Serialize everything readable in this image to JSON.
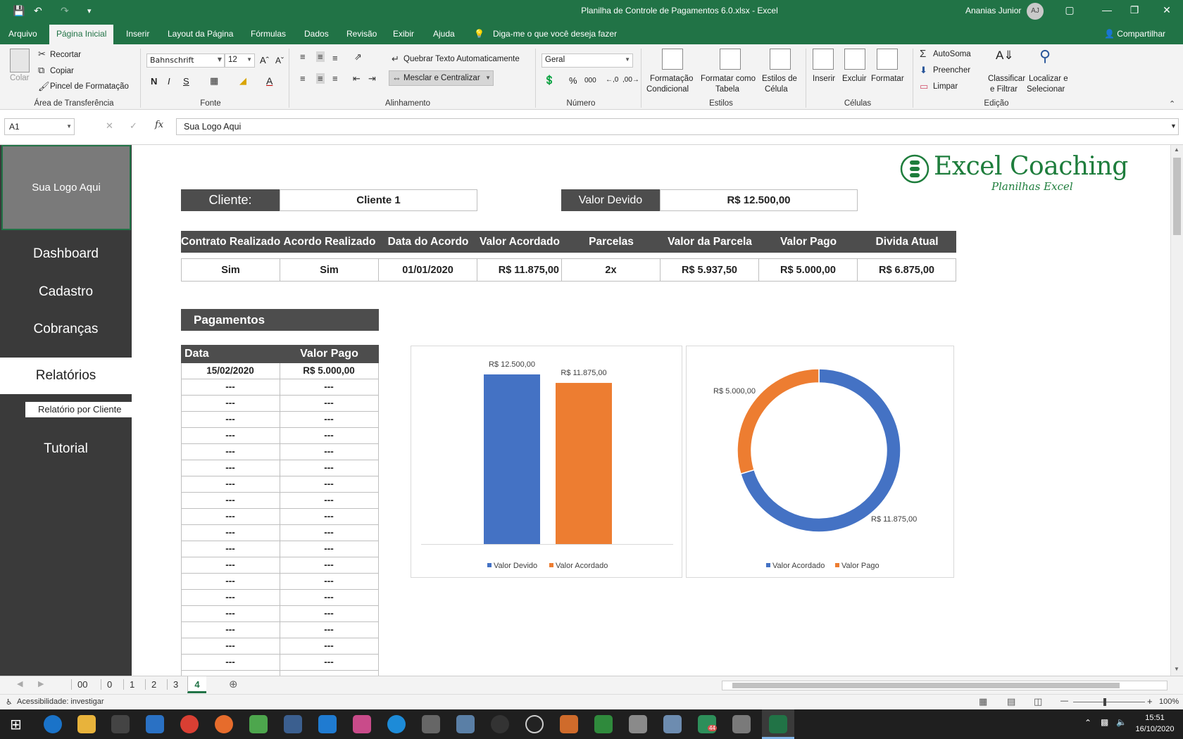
{
  "window": {
    "title": "Planilha de Controle de Pagamentos 6.0.xlsx  -  Excel",
    "user": "Ananias Junior",
    "initials": "AJ"
  },
  "menu": {
    "tabs": [
      "Arquivo",
      "Página Inicial",
      "Inserir",
      "Layout da Página",
      "Fórmulas",
      "Dados",
      "Revisão",
      "Exibir",
      "Ajuda"
    ],
    "tell_me": "Diga-me o que você deseja fazer",
    "share": "Compartilhar"
  },
  "ribbon": {
    "clipboard": {
      "paste": "Colar",
      "cut": "Recortar",
      "copy": "Copiar",
      "format_painter": "Pincel de Formatação",
      "label": "Área de Transferência"
    },
    "font": {
      "name": "Bahnschrift",
      "size": "12",
      "bold": "N",
      "italic": "I",
      "underline": "S",
      "label": "Fonte"
    },
    "alignment": {
      "wrap": "Quebrar Texto Automaticamente",
      "merge": "Mesclar e Centralizar",
      "label": "Alinhamento"
    },
    "number": {
      "format": "Geral",
      "label": "Número"
    },
    "styles": {
      "conditional": "Formatação",
      "conditional2": "Condicional",
      "table": "Formatar como",
      "table2": "Tabela",
      "cell": "Estilos de",
      "cell2": "Célula",
      "label": "Estilos"
    },
    "cells": {
      "insert": "Inserir",
      "delete": "Excluir",
      "format": "Formatar",
      "label": "Células"
    },
    "editing": {
      "autosum": "AutoSoma",
      "fill": "Preencher",
      "clear": "Limpar",
      "sort": "Classificar",
      "sort2": "e Filtrar",
      "find": "Localizar e",
      "find2": "Selecionar",
      "label": "Edição"
    }
  },
  "formula_bar": {
    "name_box": "A1",
    "value": "Sua Logo Aqui"
  },
  "sidebar": {
    "logo": "Sua Logo Aqui",
    "items": [
      "Dashboard",
      "Cadastro",
      "Cobranças",
      "Relatórios",
      "Tutorial"
    ],
    "sub_item": "Relatório por Cliente"
  },
  "brand": {
    "name": "Excel Coaching",
    "tagline": "Planilhas Excel",
    "color": "#1e7d3c"
  },
  "summary": {
    "client_label": "Cliente:",
    "client_value": "Cliente 1",
    "due_label": "Valor Devido",
    "due_value": "R$ 12.500,00"
  },
  "contract_table": {
    "headers": [
      "Contrato Realizado",
      "Acordo Realizado",
      "Data do Acordo",
      "Valor Acordado",
      "Parcelas",
      "Valor da Parcela",
      "Valor Pago",
      "Divida Atual"
    ],
    "row": [
      "Sim",
      "Sim",
      "01/01/2020",
      "R$ 11.875,00",
      "2x",
      "R$ 5.937,50",
      "R$ 5.000,00",
      "R$ 6.875,00"
    ]
  },
  "payments": {
    "title": "Pagamentos",
    "headers": [
      "Data",
      "Valor Pago"
    ],
    "rows": [
      [
        "15/02/2020",
        "R$ 5.000,00"
      ],
      [
        "---",
        "---"
      ],
      [
        "---",
        "---"
      ],
      [
        "---",
        "---"
      ],
      [
        "---",
        "---"
      ],
      [
        "---",
        "---"
      ],
      [
        "---",
        "---"
      ],
      [
        "---",
        "---"
      ],
      [
        "---",
        "---"
      ],
      [
        "---",
        "---"
      ],
      [
        "---",
        "---"
      ],
      [
        "---",
        "---"
      ],
      [
        "---",
        "---"
      ],
      [
        "---",
        "---"
      ],
      [
        "---",
        "---"
      ],
      [
        "---",
        "---"
      ],
      [
        "---",
        "---"
      ],
      [
        "---",
        "---"
      ],
      [
        "---",
        "---"
      ]
    ]
  },
  "chart_data": [
    {
      "type": "bar",
      "categories": [
        "Valor Devido",
        "Valor Acordado"
      ],
      "values": [
        12500,
        11875
      ],
      "data_labels": [
        "R$ 12.500,00",
        "R$ 11.875,00"
      ],
      "legend": [
        "Valor Devido",
        "Valor Acordado"
      ],
      "legend_position": "bottom",
      "colors": [
        "#4472c4",
        "#ed7d31"
      ],
      "grid": false
    },
    {
      "type": "pie",
      "subtype": "donut",
      "categories": [
        "Valor Acordado",
        "Valor Pago"
      ],
      "values": [
        11875,
        5000
      ],
      "data_labels": [
        "R$ 11.875,00",
        "R$ 5.000,00"
      ],
      "legend": [
        "Valor Acordado",
        "Valor Pago"
      ],
      "legend_position": "bottom",
      "colors": [
        "#4472c4",
        "#ed7d31"
      ]
    }
  ],
  "sheet_tabs": [
    "00",
    "0",
    "1",
    "2",
    "3",
    "4"
  ],
  "active_tab": "4",
  "status": {
    "accessibility": "Acessibilidade: investigar",
    "zoom": "100%"
  },
  "clock": {
    "time": "15:51",
    "date": "16/10/2020"
  },
  "taskbar": {
    "badge": "44"
  },
  "colors": {
    "excel_green": "#217346",
    "dark_header": "#4d4d4d",
    "sidebar": "#3a3a3a"
  }
}
